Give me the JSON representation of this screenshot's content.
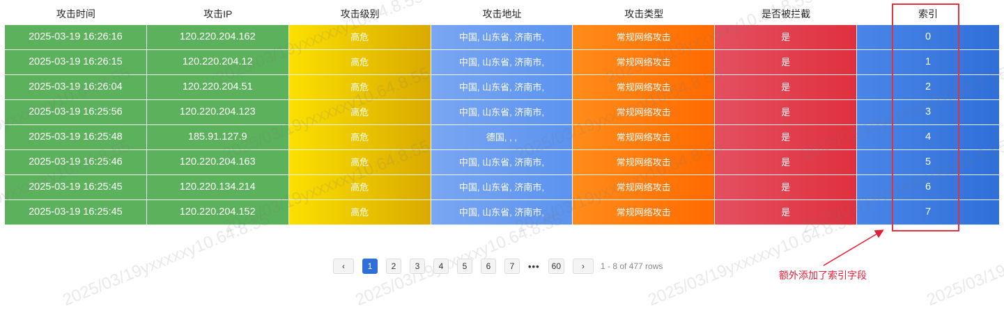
{
  "columns": [
    "攻击时间",
    "攻击IP",
    "攻击级别",
    "攻击地址",
    "攻击类型",
    "是否被拦截",
    "索引"
  ],
  "rows": [
    [
      "2025-03-19 16:26:16",
      "120.220.204.162",
      "高危",
      "中国, 山东省, 济南市,",
      "常规网络攻击",
      "是",
      "0"
    ],
    [
      "2025-03-19 16:26:15",
      "120.220.204.12",
      "高危",
      "中国, 山东省, 济南市,",
      "常规网络攻击",
      "是",
      "1"
    ],
    [
      "2025-03-19 16:26:04",
      "120.220.204.51",
      "高危",
      "中国, 山东省, 济南市,",
      "常规网络攻击",
      "是",
      "2"
    ],
    [
      "2025-03-19 16:25:56",
      "120.220.204.123",
      "高危",
      "中国, 山东省, 济南市,",
      "常规网络攻击",
      "是",
      "3"
    ],
    [
      "2025-03-19 16:25:48",
      "185.91.127.9",
      "高危",
      "德国, , ,",
      "常规网络攻击",
      "是",
      "4"
    ],
    [
      "2025-03-19 16:25:46",
      "120.220.204.163",
      "高危",
      "中国, 山东省, 济南市,",
      "常规网络攻击",
      "是",
      "5"
    ],
    [
      "2025-03-19 16:25:45",
      "120.220.134.214",
      "高危",
      "中国, 山东省, 济南市,",
      "常规网络攻击",
      "是",
      "6"
    ],
    [
      "2025-03-19 16:25:45",
      "120.220.204.152",
      "高危",
      "中国, 山东省, 济南市,",
      "常规网络攻击",
      "是",
      "7"
    ]
  ],
  "column_colors": {
    "time": "#5cb25c",
    "ip": "#5cb25c",
    "level": [
      "#fbe000",
      "#d9a900"
    ],
    "address": [
      "#7aa6f2",
      "#5b93ef"
    ],
    "type": [
      "#ff8c1a",
      "#ff6a00"
    ],
    "blocked": [
      "#e35060",
      "#e0303e"
    ],
    "index": [
      "#4a86e8",
      "#2f6fd8"
    ]
  },
  "pagination": {
    "prev_icon": "chevron-left-icon",
    "next_icon": "chevron-right-icon",
    "pages": [
      "1",
      "2",
      "3",
      "4",
      "5",
      "6",
      "7"
    ],
    "current_page": "1",
    "ellipsis": "•••",
    "last_page": "60",
    "info": "1 - 8 of 477 rows"
  },
  "annotation": {
    "text": "额外添加了索引字段",
    "color": "#e0203a"
  },
  "watermark": "2025/03/19yxxxxxy10.64.8.55"
}
